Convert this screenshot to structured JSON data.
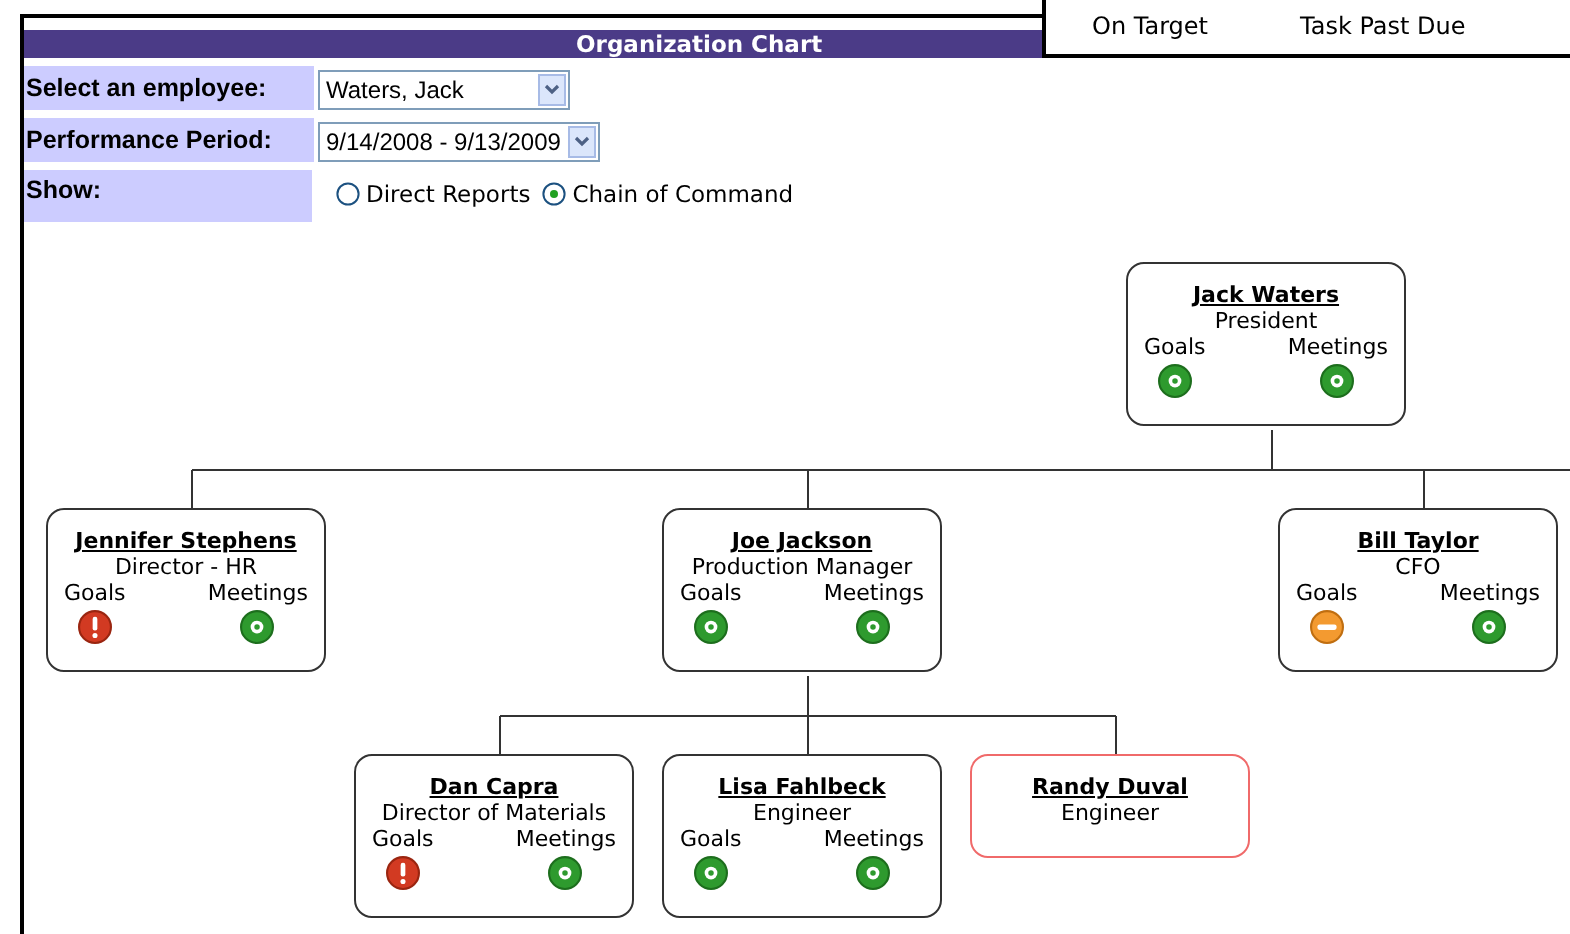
{
  "legend": {
    "items": [
      "On Target",
      "Task Past Due"
    ]
  },
  "header": {
    "title": "Organization Chart"
  },
  "form": {
    "employee": {
      "label": "Select an employee:",
      "value": "Waters, Jack"
    },
    "period": {
      "label": "Performance Period:",
      "value": "9/14/2008 - 9/13/2009"
    },
    "show": {
      "label": "Show:",
      "options": [
        {
          "label": "Direct Reports",
          "selected": false
        },
        {
          "label": "Chain of Command",
          "selected": true
        }
      ]
    }
  },
  "org_chart": {
    "root": {
      "name": "Jack Waters",
      "title": "President",
      "highlighted": false,
      "goals": {
        "label": "Goals",
        "kind": "ok"
      },
      "meetings": {
        "label": "Meetings",
        "kind": "ok"
      },
      "children": [
        {
          "name": "Jennifer Stephens",
          "title": "Director - HR",
          "highlighted": false,
          "goals": {
            "label": "Goals",
            "kind": "alert"
          },
          "meetings": {
            "label": "Meetings",
            "kind": "ok"
          }
        },
        {
          "name": "Joe Jackson",
          "title": "Production Manager",
          "highlighted": false,
          "goals": {
            "label": "Goals",
            "kind": "ok"
          },
          "meetings": {
            "label": "Meetings",
            "kind": "ok"
          },
          "children": [
            {
              "name": "Dan Capra",
              "title": "Director of Materials",
              "highlighted": false,
              "goals": {
                "label": "Goals",
                "kind": "alert"
              },
              "meetings": {
                "label": "Meetings",
                "kind": "ok"
              }
            },
            {
              "name": "Lisa Fahlbeck",
              "title": "Engineer",
              "highlighted": false,
              "goals": {
                "label": "Goals",
                "kind": "ok"
              },
              "meetings": {
                "label": "Meetings",
                "kind": "ok"
              }
            },
            {
              "name": "Randy Duval",
              "title": "Engineer",
              "highlighted": true
            }
          ]
        },
        {
          "name": "Bill Taylor",
          "title": "CFO",
          "highlighted": false,
          "goals": {
            "label": "Goals",
            "kind": "warning"
          },
          "meetings": {
            "label": "Meetings",
            "kind": "ok"
          }
        }
      ]
    }
  }
}
